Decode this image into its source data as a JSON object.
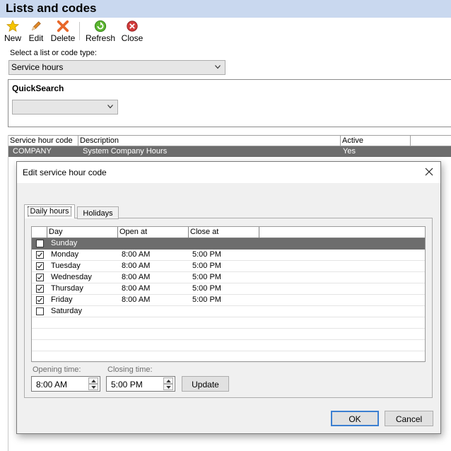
{
  "window": {
    "title": "Lists and codes"
  },
  "toolbar": {
    "new_label": "New",
    "edit_label": "Edit",
    "delete_label": "Delete",
    "refresh_label": "Refresh",
    "close_label": "Close"
  },
  "selector": {
    "label": "Select a list or code type:",
    "value": "Service hours"
  },
  "quicksearch": {
    "title": "QuickSearch",
    "value": ""
  },
  "main_grid": {
    "columns": [
      "Service hour code",
      "Description",
      "Active"
    ],
    "rows": [
      {
        "code": "COMPANY",
        "description": "System Company Hours",
        "active": "Yes"
      }
    ]
  },
  "dialog": {
    "title": "Edit service hour code",
    "tabs": [
      "Daily hours",
      "Holidays"
    ],
    "grid": {
      "columns": [
        "Day",
        "Open at",
        "Close at"
      ],
      "rows": [
        {
          "day": "Sunday",
          "checked": false,
          "open": "",
          "close": ""
        },
        {
          "day": "Monday",
          "checked": true,
          "open": "8:00 AM",
          "close": "5:00 PM"
        },
        {
          "day": "Tuesday",
          "checked": true,
          "open": "8:00 AM",
          "close": "5:00 PM"
        },
        {
          "day": "Wednesday",
          "checked": true,
          "open": "8:00 AM",
          "close": "5:00 PM"
        },
        {
          "day": "Thursday",
          "checked": true,
          "open": "8:00 AM",
          "close": "5:00 PM"
        },
        {
          "day": "Friday",
          "checked": true,
          "open": "8:00 AM",
          "close": "5:00 PM"
        },
        {
          "day": "Saturday",
          "checked": false,
          "open": "",
          "close": ""
        }
      ]
    },
    "opening_time": {
      "label": "Opening time:",
      "value": "8:00 AM"
    },
    "closing_time": {
      "label": "Closing time:",
      "value": "5:00 PM"
    },
    "update_label": "Update",
    "ok_label": "OK",
    "cancel_label": "Cancel"
  },
  "colors": {
    "titlebar": "#c9d8ef",
    "selected_row": "#6d6d6d",
    "default_button_border": "#3c7fd1",
    "new_icon": "#f5c400",
    "edit_icon": "#e0892a",
    "delete_icon": "#e8682a",
    "refresh_icon": "#5cb531",
    "close_icon": "#d23b3b"
  },
  "icons": [
    "star-icon",
    "pencil-icon",
    "x-icon",
    "refresh-icon",
    "close-circle-icon",
    "chevron-down-icon",
    "close-icon",
    "checkmark-icon"
  ]
}
